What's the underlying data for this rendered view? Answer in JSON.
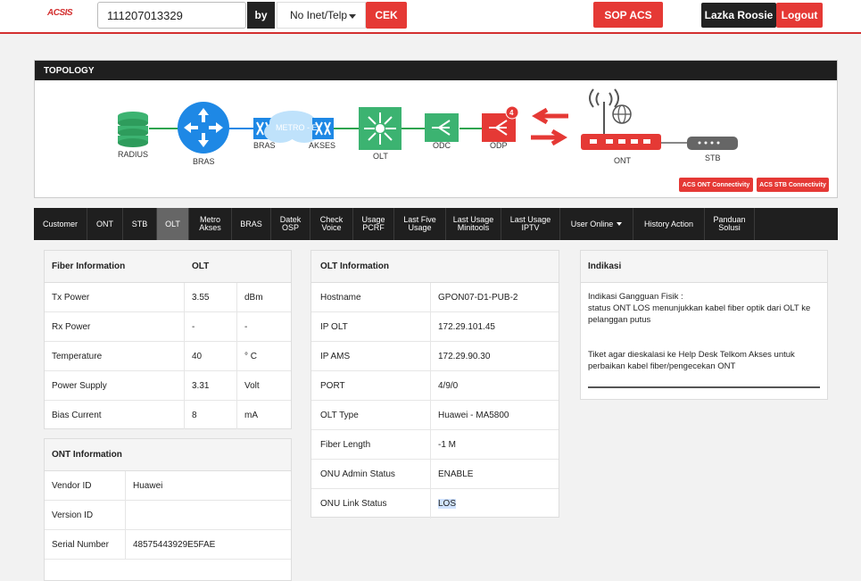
{
  "header": {
    "logo": "ACSIS",
    "search_value": "111207013329",
    "by_label": "by",
    "select_value": "No Inet/Telp",
    "cek_label": "CEK",
    "sop_label": "SOP ACS",
    "user_name": "Lazka Roosie",
    "logout_label": "Logout"
  },
  "topology": {
    "title": "TOPOLOGY",
    "nodes": {
      "radius": "RADIUS",
      "bras": "BRAS",
      "bras2": "BRAS",
      "metro": "METRO - E",
      "akses": "AKSES",
      "olt": "OLT",
      "odc": "ODC",
      "odp": "ODP",
      "odp_badge": "4",
      "ont": "ONT",
      "stb": "STB"
    },
    "ont_connectivity": "ACS ONT Connectivity",
    "stb_connectivity": "ACS STB Connectivity",
    "colors": {
      "link": "#2ea44f",
      "accent": "#e53935",
      "bras": "#1e88e5",
      "green": "#3cb371"
    }
  },
  "tabs": [
    {
      "l1": "Customer",
      "l2": ""
    },
    {
      "l1": "ONT",
      "l2": ""
    },
    {
      "l1": "STB",
      "l2": ""
    },
    {
      "l1": "OLT",
      "l2": ""
    },
    {
      "l1": "Metro",
      "l2": "Akses"
    },
    {
      "l1": "BRAS",
      "l2": ""
    },
    {
      "l1": "Datek",
      "l2": "OSP"
    },
    {
      "l1": "Check",
      "l2": "Voice"
    },
    {
      "l1": "Usage",
      "l2": "PCRF"
    },
    {
      "l1": "Last Five",
      "l2": "Usage"
    },
    {
      "l1": "Last Usage",
      "l2": "Minitools"
    },
    {
      "l1": "Last Usage",
      "l2": "IPTV"
    },
    {
      "l1": "User Online",
      "l2": ""
    },
    {
      "l1": "History Action",
      "l2": ""
    },
    {
      "l1": "Panduan",
      "l2": "Solusi"
    }
  ],
  "fiber": {
    "head1": "Fiber Information",
    "head2": "OLT",
    "rows": [
      {
        "label": "Tx Power",
        "value": "3.55",
        "unit": "dBm"
      },
      {
        "label": "Rx Power",
        "value": "-",
        "unit": "-"
      },
      {
        "label": "Temperature",
        "value": "40",
        "unit": "° C"
      },
      {
        "label": "Power Supply",
        "value": "3.31",
        "unit": "Volt"
      },
      {
        "label": "Bias Current",
        "value": "8",
        "unit": "mA"
      }
    ]
  },
  "ont": {
    "head": "ONT Information",
    "rows": [
      {
        "label": "Vendor ID",
        "value": "Huawei"
      },
      {
        "label": "Version ID",
        "value": ""
      },
      {
        "label": "Serial Number",
        "value": "48575443929E5FAE"
      }
    ]
  },
  "olt": {
    "head": "OLT Information",
    "rows": [
      {
        "label": "Hostname",
        "value": "GPON07-D1-PUB-2"
      },
      {
        "label": "IP OLT",
        "value": "172.29.101.45"
      },
      {
        "label": "IP AMS",
        "value": "172.29.90.30"
      },
      {
        "label": "PORT",
        "value": "4/9/0"
      },
      {
        "label": "OLT Type",
        "value": "Huawei - MA5800"
      },
      {
        "label": "Fiber Length",
        "value": "-1 M"
      },
      {
        "label": "ONU Admin Status",
        "value": "ENABLE"
      },
      {
        "label": "ONU Link Status",
        "value": "LOS"
      }
    ]
  },
  "indikasi": {
    "head": "Indikasi",
    "line1": "Indikasi Gangguan Fisik :",
    "line2": "status ONT LOS menunjukkan kabel fiber optik dari OLT ke pelanggan putus",
    "line3": "Tiket agar dieskalasi ke Help Desk Telkom Akses untuk perbaikan kabel fiber/pengecekan ONT"
  }
}
